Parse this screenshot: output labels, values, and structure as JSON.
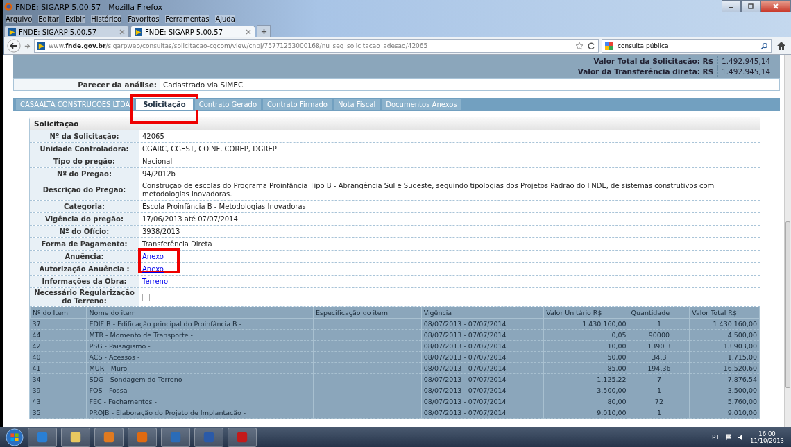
{
  "window": {
    "title": "FNDE: SIGARP 5.00.57 - Mozilla Firefox"
  },
  "menu": [
    "Arquivo",
    "Editar",
    "Exibir",
    "Histórico",
    "Favoritos",
    "Ferramentas",
    "Ajuda"
  ],
  "browser_tabs": [
    {
      "label": "FNDE: SIGARP 5.00.57",
      "selected": false
    },
    {
      "label": "FNDE: SIGARP 5.00.57",
      "selected": true
    }
  ],
  "address": {
    "prefix": "www.",
    "domain": "fnde.gov.br",
    "path": "/sigarpweb/consultas/solicitacao-cgcom/view/cnpj/75771253000168/nu_seq_solicitacao_adesao/42065"
  },
  "search": {
    "value": "consulta pública"
  },
  "totals": [
    {
      "label": "Valor Total da Solicitação: R$",
      "value": "1.492.945,14"
    },
    {
      "label": "Valor da Transferência direta: R$",
      "value": "1.492.945,14"
    }
  ],
  "parecer": {
    "label": "Parecer da análise:",
    "value": "Cadastrado via SIMEC"
  },
  "page_tabs": [
    {
      "label": "CASAALTA CONSTRUCOES LTDA",
      "selected": false
    },
    {
      "label": "Solicitação",
      "selected": true,
      "highlighted": true
    },
    {
      "label": "Contrato Gerado",
      "selected": false
    },
    {
      "label": "Contrato Firmado",
      "selected": false
    },
    {
      "label": "Nota Fiscal",
      "selected": false
    },
    {
      "label": "Documentos Anexos",
      "selected": false
    }
  ],
  "section": {
    "title": "Solicitação",
    "fields": [
      {
        "kind": "text",
        "label": "Nº da Solicitação:",
        "value": "42065"
      },
      {
        "kind": "text",
        "label": "Unidade Controladora:",
        "value": "CGARC, CGEST, COINF, COREP, DGREP"
      },
      {
        "kind": "text",
        "label": "Tipo do pregão:",
        "value": "Nacional"
      },
      {
        "kind": "text",
        "label": "Nº do Pregão:",
        "value": "94/2012b"
      },
      {
        "kind": "text",
        "label": "Descrição do Pregão:",
        "value": "Construção de escolas do Programa Proinfância Tipo B - Abrangência Sul e Sudeste, seguindo tipologias dos Projetos Padrão do FNDE, de sistemas construtivos com metodologias inovadoras."
      },
      {
        "kind": "text",
        "label": "Categoria:",
        "value": "Escola Proinfância B - Metodologias Inovadoras"
      },
      {
        "kind": "text",
        "label": "Vigência do pregão:",
        "value": "17/06/2013 até 07/07/2014"
      },
      {
        "kind": "text",
        "label": "Nº do Ofício:",
        "value": "3938/2013"
      },
      {
        "kind": "text",
        "label": "Forma de Pagamento:",
        "value": "Transferência Direta"
      },
      {
        "kind": "link",
        "label": "Anuência:",
        "value": "Anexo",
        "highlighted": true
      },
      {
        "kind": "link",
        "label": "Autorização Anuência :",
        "value": "Anexo"
      },
      {
        "kind": "link",
        "label": "Informações da Obra:",
        "value": "Terreno"
      },
      {
        "kind": "checkbox",
        "label": "Necessário Regularização do Terreno:",
        "checked": false
      }
    ]
  },
  "items": {
    "columns": [
      "Nº do Item",
      "Nome do item",
      "Especificação do item",
      "Vigência",
      "Valor Unitário R$",
      "Quantidade",
      "Valor Total R$"
    ],
    "rows": [
      {
        "no": "37",
        "name": "EDIF B - Edificação principal do Proinfância B -",
        "period": "08/07/2013 - 07/07/2014",
        "unit": "1.430.160,00",
        "qty": "1",
        "total": "1.430.160,00"
      },
      {
        "no": "44",
        "name": "MTR - Momento de Transporte -",
        "period": "08/07/2013 - 07/07/2014",
        "unit": "0,05",
        "qty": "90000",
        "total": "4.500,00"
      },
      {
        "no": "42",
        "name": "PSG - Paisagismo -",
        "period": "08/07/2013 - 07/07/2014",
        "unit": "10,00",
        "qty": "1390.3",
        "total": "13.903,00"
      },
      {
        "no": "40",
        "name": "ACS - Acessos -",
        "period": "08/07/2013 - 07/07/2014",
        "unit": "50,00",
        "qty": "34.3",
        "total": "1.715,00"
      },
      {
        "no": "41",
        "name": "MUR - Muro -",
        "period": "08/07/2013 - 07/07/2014",
        "unit": "85,00",
        "qty": "194.36",
        "total": "16.520,60"
      },
      {
        "no": "34",
        "name": "SDG - Sondagem do Terreno -",
        "period": "08/07/2013 - 07/07/2014",
        "unit": "1.125,22",
        "qty": "7",
        "total": "7.876,54"
      },
      {
        "no": "39",
        "name": "FOS - Fossa -",
        "period": "08/07/2013 - 07/07/2014",
        "unit": "3.500,00",
        "qty": "1",
        "total": "3.500,00"
      },
      {
        "no": "43",
        "name": "FEC - Fechamentos -",
        "period": "08/07/2013 - 07/07/2014",
        "unit": "80,00",
        "qty": "72",
        "total": "5.760,00"
      },
      {
        "no": "35",
        "name": "PROJB - Elaboração do Projeto de Implantação -",
        "period": "08/07/2013 - 07/07/2014",
        "unit": "9.010,00",
        "qty": "1",
        "total": "9.010,00"
      }
    ]
  },
  "taskbar": {
    "language": "PT",
    "time": "16:00",
    "date": "11/10/2013"
  }
}
